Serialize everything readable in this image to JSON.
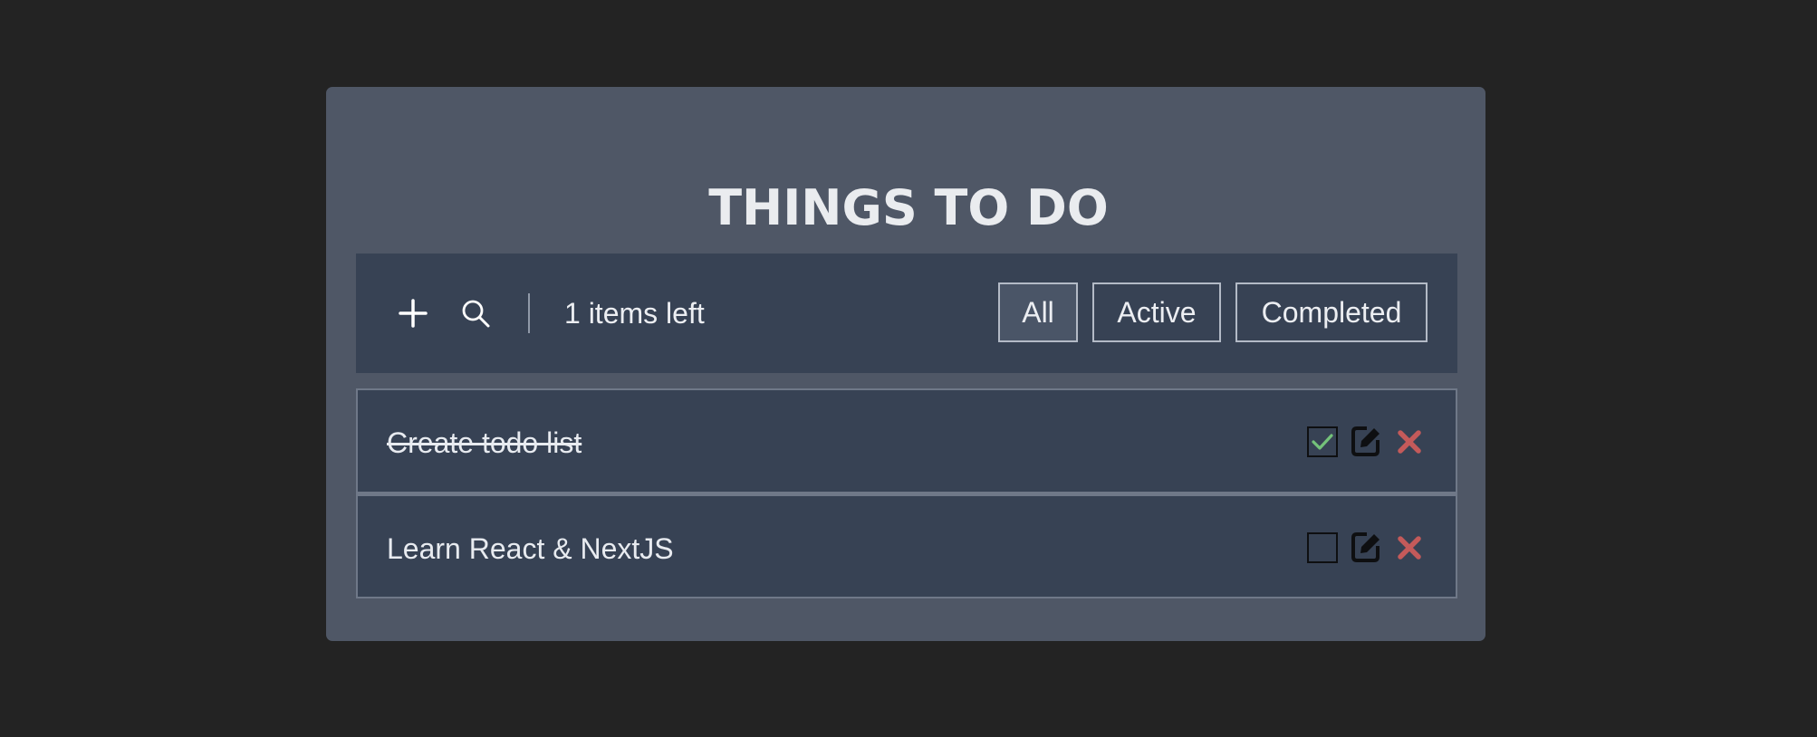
{
  "app": {
    "title": "THINGS TO DO"
  },
  "toolbar": {
    "add_icon": "plus-icon",
    "search_icon": "search-icon",
    "items_left": "1 items left",
    "filters": [
      {
        "label": "All",
        "selected": true
      },
      {
        "label": "Active",
        "selected": false
      },
      {
        "label": "Completed",
        "selected": false
      }
    ]
  },
  "todos": [
    {
      "text": "Create todo list",
      "completed": true
    },
    {
      "text": "Learn React & NextJS",
      "completed": false
    }
  ],
  "colors": {
    "background": "#232323",
    "card": "#4f5766",
    "panel": "#374254",
    "check": "#74c27a",
    "delete": "#c45a5a"
  }
}
